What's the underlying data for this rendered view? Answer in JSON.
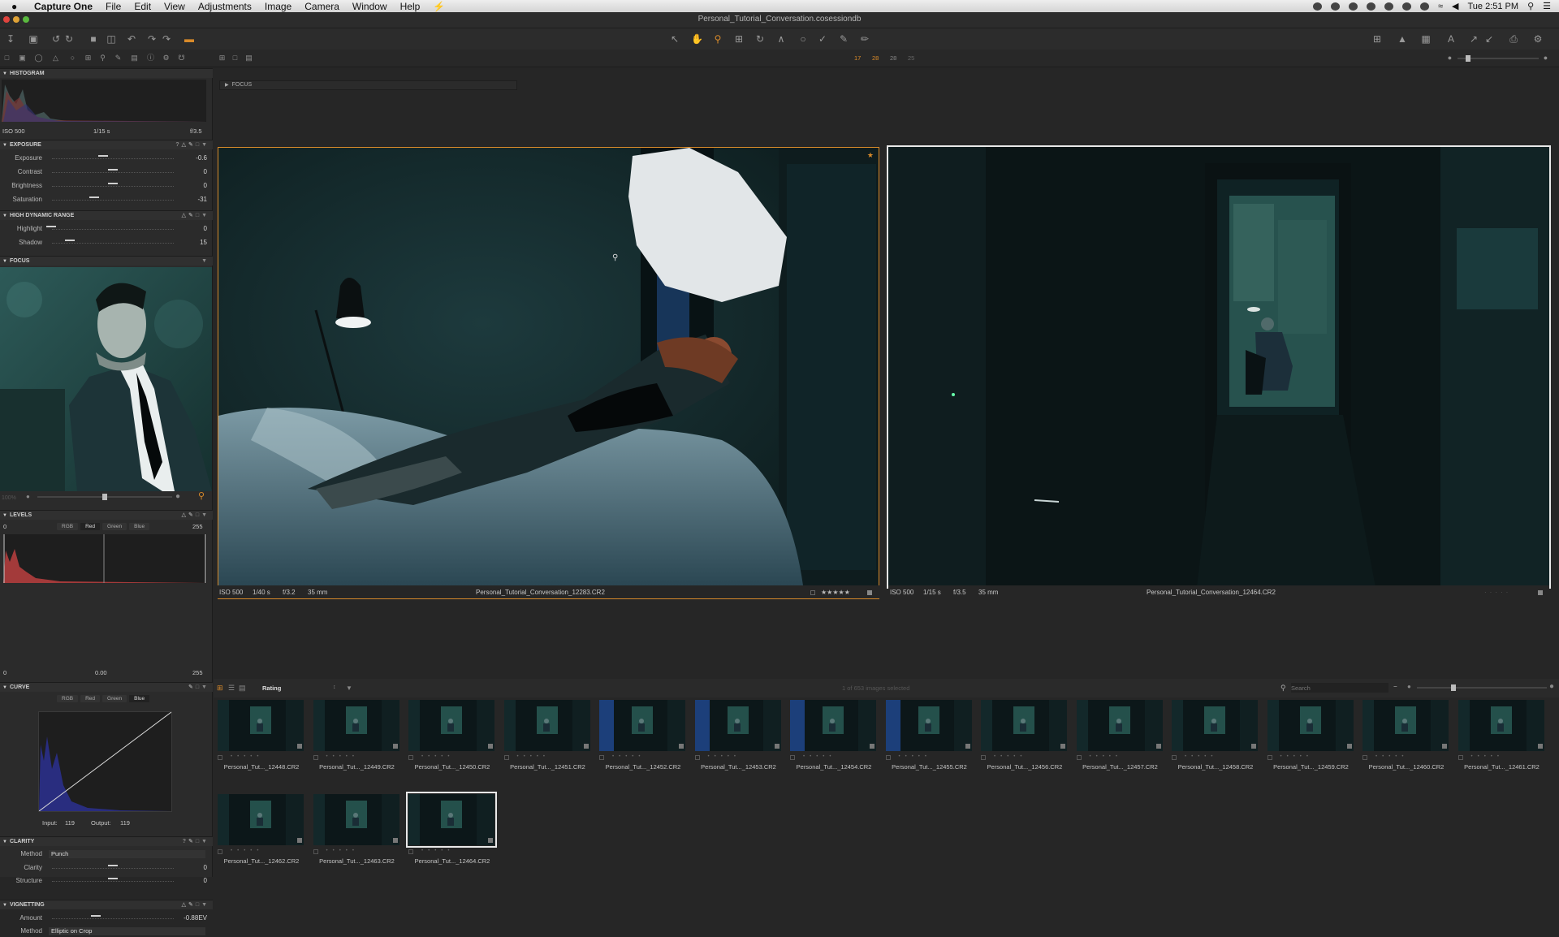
{
  "menubar": {
    "app_name": "Capture One",
    "items": [
      "File",
      "Edit",
      "View",
      "Adjustments",
      "Image",
      "Camera",
      "Window",
      "Help"
    ],
    "clock": "Tue 2:51 PM"
  },
  "window": {
    "title": "Personal_Tutorial_Conversation.cosessiondb"
  },
  "viewer_counters": [
    "17",
    "28",
    "28",
    "25"
  ],
  "histogram": {
    "title": "HISTOGRAM",
    "iso": "ISO 500",
    "shutter": "1/15 s",
    "aperture": "f/3.5"
  },
  "exposure": {
    "title": "EXPOSURE",
    "rows": [
      {
        "label": "Exposure",
        "value": "-0.6"
      },
      {
        "label": "Contrast",
        "value": "0"
      },
      {
        "label": "Brightness",
        "value": "0"
      },
      {
        "label": "Saturation",
        "value": "-31"
      }
    ]
  },
  "hdr": {
    "title": "HIGH DYNAMIC RANGE",
    "rows": [
      {
        "label": "Highlight",
        "value": "0"
      },
      {
        "label": "Shadow",
        "value": "15"
      }
    ]
  },
  "focus_panel": {
    "title": "FOCUS",
    "zoom": "100%"
  },
  "levels": {
    "title": "LEVELS",
    "low": "0",
    "high": "255",
    "tabs": [
      "RGB",
      "Red",
      "Green",
      "Blue"
    ],
    "active_tab": "Red",
    "out_low": "0",
    "mid": "0.00",
    "out_high": "255"
  },
  "curve": {
    "title": "CURVE",
    "tabs": [
      "RGB",
      "Red",
      "Green",
      "Blue"
    ],
    "active_tab": "Blue",
    "input_label": "Input:",
    "input_value": "119",
    "output_label": "Output:",
    "output_value": "119"
  },
  "clarity": {
    "title": "CLARITY",
    "method_label": "Method",
    "method_value": "Punch",
    "rows": [
      {
        "label": "Clarity",
        "value": "0"
      },
      {
        "label": "Structure",
        "value": "0"
      }
    ]
  },
  "vignetting": {
    "title": "VIGNETTING",
    "amount_label": "Amount",
    "amount_value": "-0.88EV",
    "method_label": "Method",
    "method_value": "Elliptic on Crop"
  },
  "viewer": {
    "focus_label": "FOCUS",
    "left": {
      "iso": "ISO 500",
      "shutter": "1/40 s",
      "aperture": "f/3.2",
      "focal": "35 mm",
      "filename": "Personal_Tutorial_Conversation_12283.CR2",
      "stars": "★★★★★"
    },
    "right": {
      "iso": "ISO 500",
      "shutter": "1/15 s",
      "aperture": "f/3.5",
      "focal": "35 mm",
      "filename": "Personal_Tutorial_Conversation_12464.CR2"
    }
  },
  "browser": {
    "sort_label": "Rating",
    "selection_count": "1 of 653 images selected",
    "search_placeholder": "Search",
    "thumbs": [
      "Personal_Tut..._12448.CR2",
      "Personal_Tut..._12449.CR2",
      "Personal_Tut..._12450.CR2",
      "Personal_Tut..._12451.CR2",
      "Personal_Tut..._12452.CR2",
      "Personal_Tut..._12453.CR2",
      "Personal_Tut..._12454.CR2",
      "Personal_Tut..._12455.CR2",
      "Personal_Tut..._12456.CR2",
      "Personal_Tut..._12457.CR2",
      "Personal_Tut..._12458.CR2",
      "Personal_Tut..._12459.CR2",
      "Personal_Tut..._12460.CR2",
      "Personal_Tut..._12461.CR2",
      "Personal_Tut..._12462.CR2",
      "Personal_Tut..._12463.CR2",
      "Personal_Tut..._12464.CR2"
    ],
    "selected_index": 16
  },
  "colors": {
    "accent_orange": "#d88a2a",
    "selection_white": "#e8e8e8",
    "panel_bg": "#2b2b2b"
  }
}
